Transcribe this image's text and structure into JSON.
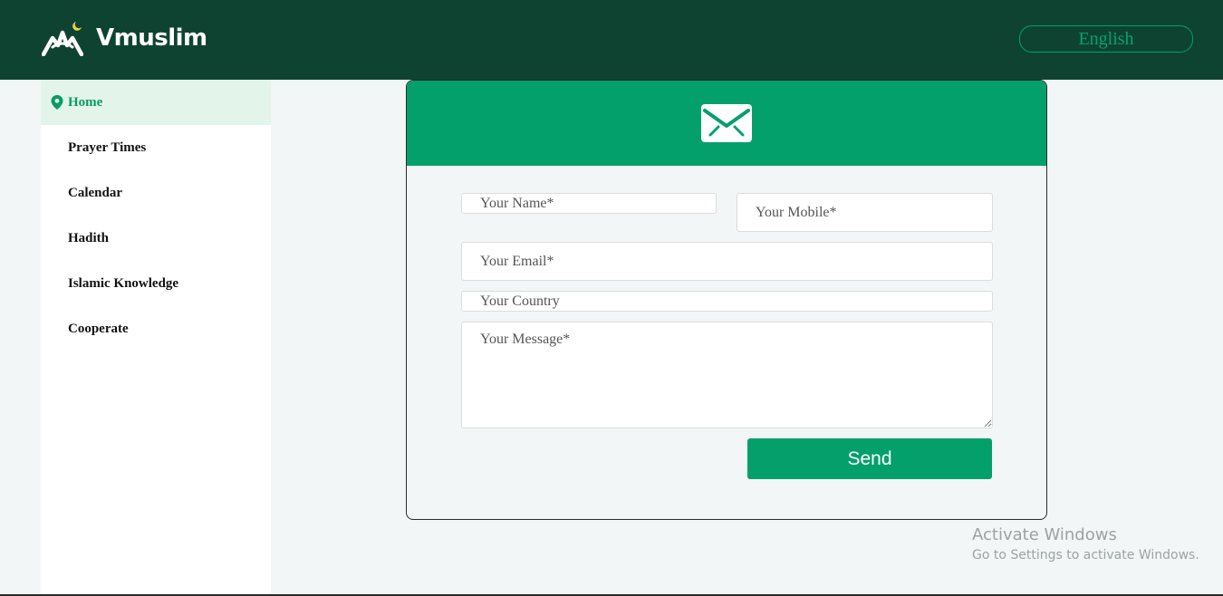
{
  "header": {
    "app_name": "Vmuslim",
    "language_button": "English"
  },
  "sidebar": {
    "items": [
      {
        "label": "Home",
        "active": true
      },
      {
        "label": "Prayer Times"
      },
      {
        "label": "Calendar"
      },
      {
        "label": "Hadith"
      },
      {
        "label": "Islamic Knowledge"
      },
      {
        "label": "Cooperate"
      }
    ]
  },
  "contact_form": {
    "header_icon": "envelope-icon",
    "name_placeholder": "Your Name*",
    "mobile_placeholder": "Your Mobile*",
    "email_placeholder": "Your Email*",
    "country_placeholder": "Your Country",
    "message_placeholder": "Your Message*",
    "send_label": "Send"
  },
  "watermark": {
    "title": "Activate Windows",
    "subtitle": "Go to Settings to activate Windows."
  },
  "colors": {
    "header_bg": "#0e4332",
    "accent": "#03a06b",
    "active_nav_bg": "#e3f4ea",
    "page_bg": "#f2f6f6"
  }
}
